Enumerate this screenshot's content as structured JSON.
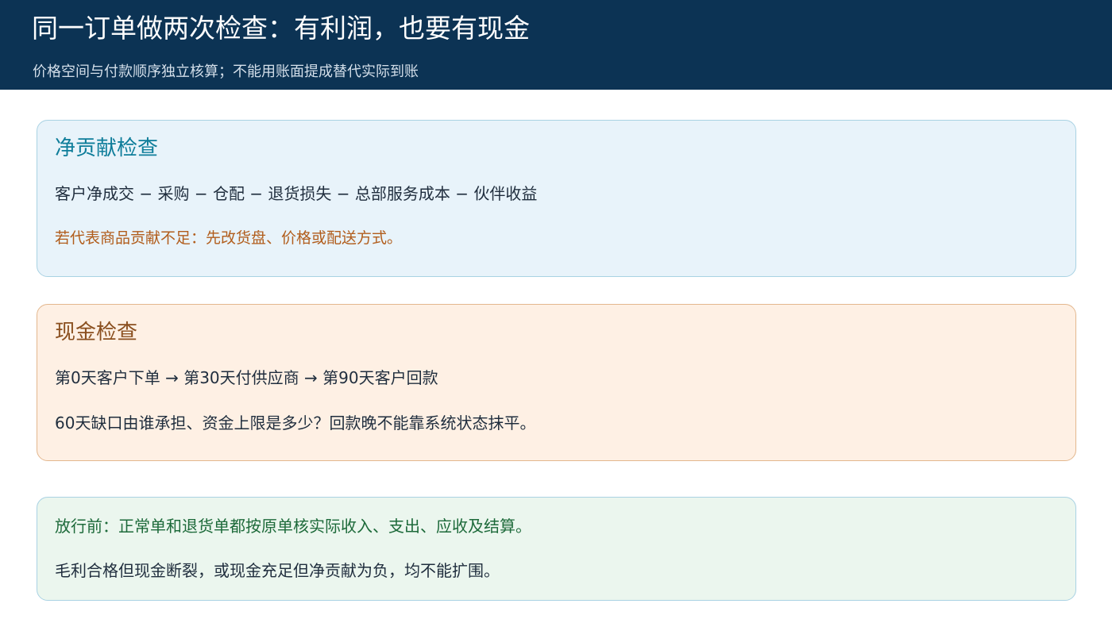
{
  "header": {
    "title": "同一订单做两次检查：有利润，也要有现金",
    "subtitle": "价格空间与付款顺序独立核算；不能用账面提成替代实际到账"
  },
  "contribution_check": {
    "title": "净贡献检查",
    "formula": "客户净成交 − 采购 − 仓配 − 退货损失 − 总部服务成本 − 伙伴收益",
    "note": "若代表商品贡献不足：先改货盘、价格或配送方式。"
  },
  "cash_check": {
    "title": "现金检查",
    "timeline": "第0天客户下单 → 第30天付供应商 → 第90天客户回款",
    "question": "60天缺口由谁承担、资金上限是多少？回款晚不能靠系统状态抹平。"
  },
  "release_check": {
    "line1": "放行前：正常单和退货单都按原单核实际收入、支出、应收及结算。",
    "line2": "毛利合格但现金断裂，或现金充足但净贡献为负，均不能扩围。"
  },
  "colors": {
    "header_bg": "#0c3354",
    "contribution_bg": "#e8f3fa",
    "cash_bg": "#fef0e4",
    "release_bg": "#ebf6ee",
    "accent_teal": "#0e7d9a",
    "accent_brown": "#8a4f1f",
    "accent_green": "#1d6a3a"
  }
}
